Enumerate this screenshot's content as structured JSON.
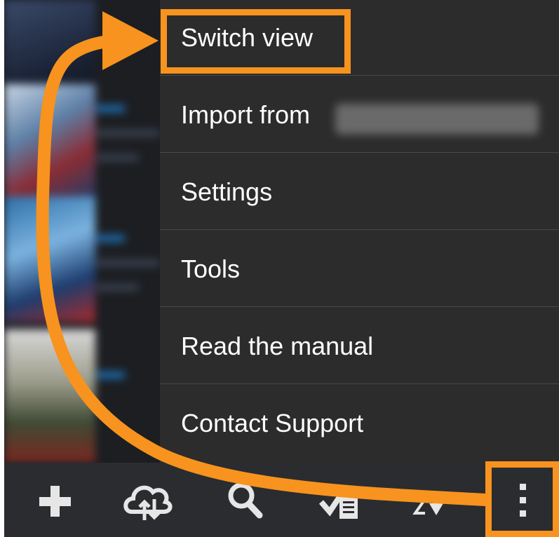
{
  "menu": {
    "items": [
      {
        "label": "Switch view"
      },
      {
        "label": "Import from"
      },
      {
        "label": "Settings"
      },
      {
        "label": "Tools"
      },
      {
        "label": "Read the manual"
      },
      {
        "label": "Contact Support"
      }
    ]
  },
  "toolbar": {
    "buttons": [
      {
        "icon": "plus-icon"
      },
      {
        "icon": "cloud-sync-icon"
      },
      {
        "icon": "search-icon"
      },
      {
        "icon": "select-checklist-icon"
      },
      {
        "icon": "sort-az-icon"
      },
      {
        "icon": "more-vertical-icon"
      }
    ]
  },
  "colors": {
    "highlight": "#f7931e",
    "menu_bg": "#2c2c2c",
    "toolbar_bg": "#2a2c30"
  }
}
